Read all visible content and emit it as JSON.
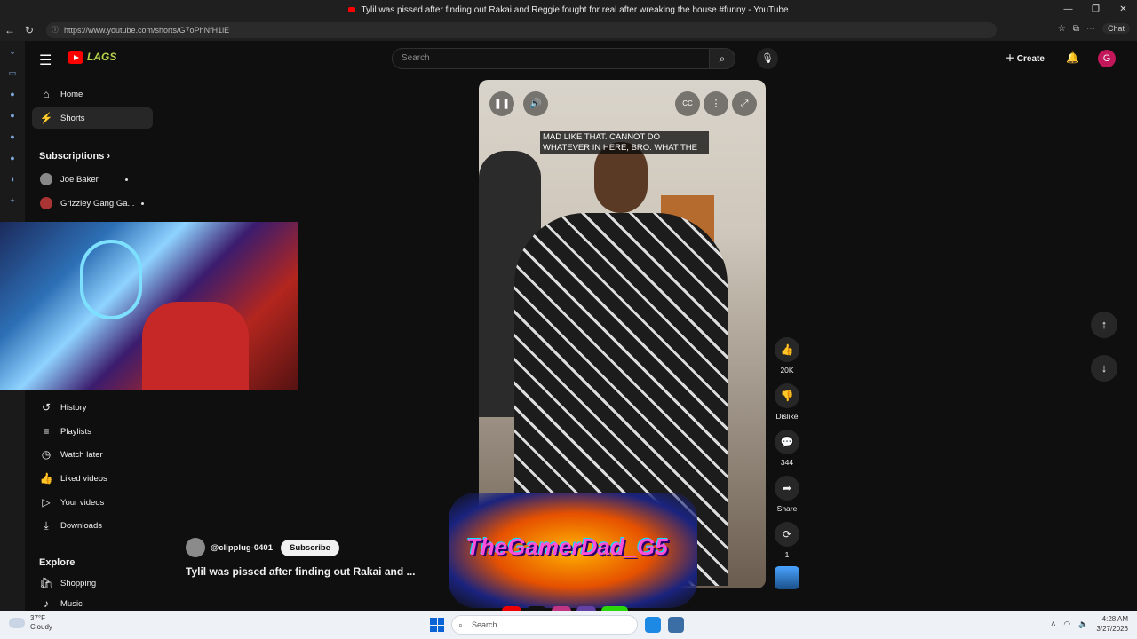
{
  "window": {
    "title": "Tylil was pissed after finding out Rakai and Reggie fought for real after wreaking the house #funny - YouTube",
    "controls": [
      "—",
      "❐",
      "✕"
    ]
  },
  "browser": {
    "url": "https://www.youtube.com/shorts/G7oPhNfH1lE",
    "chat_label": "Chat"
  },
  "masthead": {
    "search_placeholder": "Search",
    "create_label": "Create",
    "avatar_letter": "G",
    "logo_art_text": "LAGS"
  },
  "sidebar": {
    "top": [
      {
        "label": "Home",
        "icon": "home-icon"
      },
      {
        "label": "Shorts",
        "icon": "shorts-icon",
        "active": true
      }
    ],
    "subscriptions_heading": "Subscriptions",
    "subscriptions": [
      {
        "label": "Joe Baker"
      },
      {
        "label": "Grizzley Gang Ga..."
      }
    ],
    "you": [
      {
        "label": "History",
        "icon": "history-icon"
      },
      {
        "label": "Playlists",
        "icon": "playlists-icon"
      },
      {
        "label": "Watch later",
        "icon": "watch-later-icon"
      },
      {
        "label": "Liked videos",
        "icon": "liked-videos-icon"
      },
      {
        "label": "Your videos",
        "icon": "your-videos-icon"
      },
      {
        "label": "Downloads",
        "icon": "downloads-icon"
      }
    ],
    "explore_heading": "Explore",
    "explore": [
      {
        "label": "Shopping",
        "icon": "shopping-icon"
      },
      {
        "label": "Music",
        "icon": "music-icon"
      }
    ]
  },
  "player": {
    "caption": "MAD LIKE THAT. CANNOT DO WHATEVER IN HERE, BRO. WHAT THE"
  },
  "actions": {
    "like_count": "20K",
    "dislike_label": "Dislike",
    "comment_count": "344",
    "share_label": "Share",
    "remix_count": "1"
  },
  "video": {
    "channel": "@clipplug-0401",
    "subscribe_label": "Subscribe",
    "title": "Tylil was pissed after finding out Rakai and ..."
  },
  "overlay": {
    "logo_text": "TheGamerDad_G5",
    "socials": [
      "▶",
      "♪",
      "◎",
      "▣",
      "KICK"
    ]
  },
  "taskbar": {
    "temperature": "37°F",
    "weather": "Cloudy",
    "search_placeholder": "Search",
    "time": "4:28 AM",
    "date": "3/27/2026"
  },
  "colors": {
    "accent_red": "#ff0000",
    "background": "#0f0f0f",
    "active_item": "#272727"
  }
}
